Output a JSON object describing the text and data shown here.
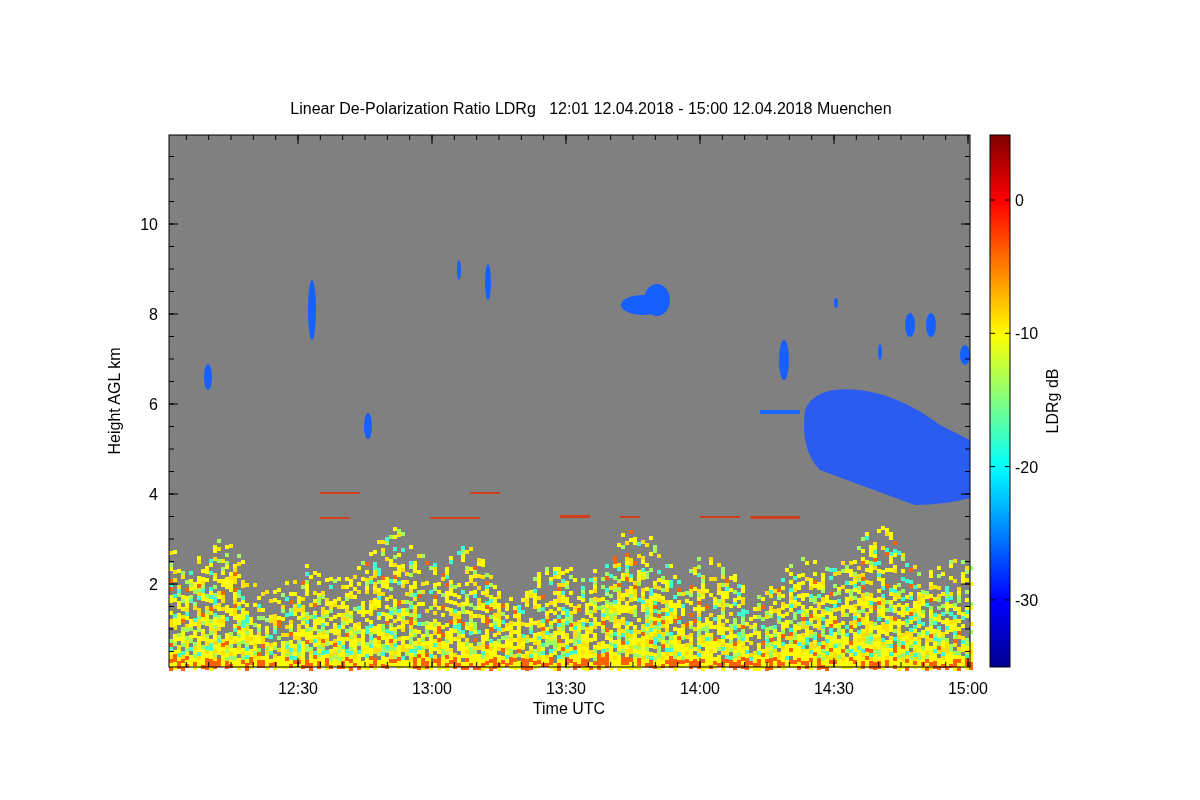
{
  "title": "Linear De-Polarization Ratio LDRg   12:01 12.04.2018 - 15:00 12.04.2018 Muenchen",
  "plot": {
    "xlabel": "Time UTC",
    "ylabel": "Height AGL km",
    "xticks": [
      "12:30",
      "13:00",
      "13:30",
      "14:00",
      "14:30",
      "15:00"
    ],
    "yticks": [
      "10",
      "8",
      "6",
      "4",
      "2"
    ]
  },
  "colorbar": {
    "label": "LDRg dB",
    "ticks": [
      "0",
      "-10",
      "-20",
      "-30"
    ]
  }
}
